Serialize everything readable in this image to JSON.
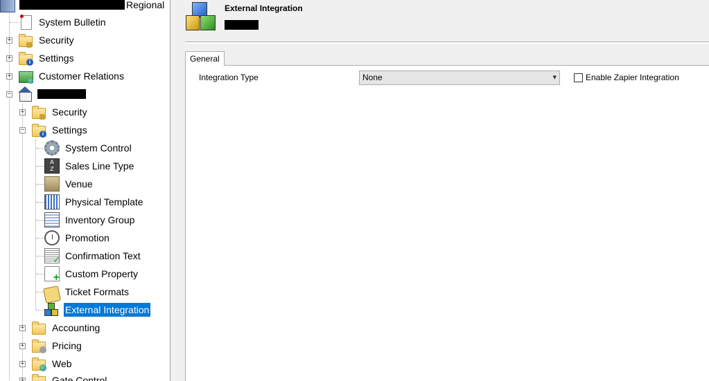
{
  "tree": {
    "root_suffix": "Regional",
    "items": [
      {
        "label": "System Bulletin"
      },
      {
        "label": "Security"
      },
      {
        "label": "Settings"
      },
      {
        "label": "Customer Relations"
      },
      {
        "label": "Security"
      },
      {
        "label": "Settings"
      },
      {
        "label": "System Control"
      },
      {
        "label": "Sales Line Type"
      },
      {
        "label": "Venue"
      },
      {
        "label": "Physical Template"
      },
      {
        "label": "Inventory Group"
      },
      {
        "label": "Promotion"
      },
      {
        "label": "Confirmation Text"
      },
      {
        "label": "Custom Property"
      },
      {
        "label": "Ticket Formats"
      },
      {
        "label": "External Integration"
      },
      {
        "label": "Accounting"
      },
      {
        "label": "Pricing"
      },
      {
        "label": "Web"
      },
      {
        "label": "Gate Control"
      }
    ],
    "selected_color": "#0078d7"
  },
  "header": {
    "title": "External Integration"
  },
  "tabs": [
    {
      "label": "General"
    }
  ],
  "form": {
    "integration_type_label": "Integration Type",
    "integration_type_value": "None",
    "enable_zapier_label": "Enable Zapier Integration",
    "enable_zapier_checked": false
  },
  "icons": {
    "expand": "+",
    "collapse": "−",
    "dropdown": "▾"
  }
}
